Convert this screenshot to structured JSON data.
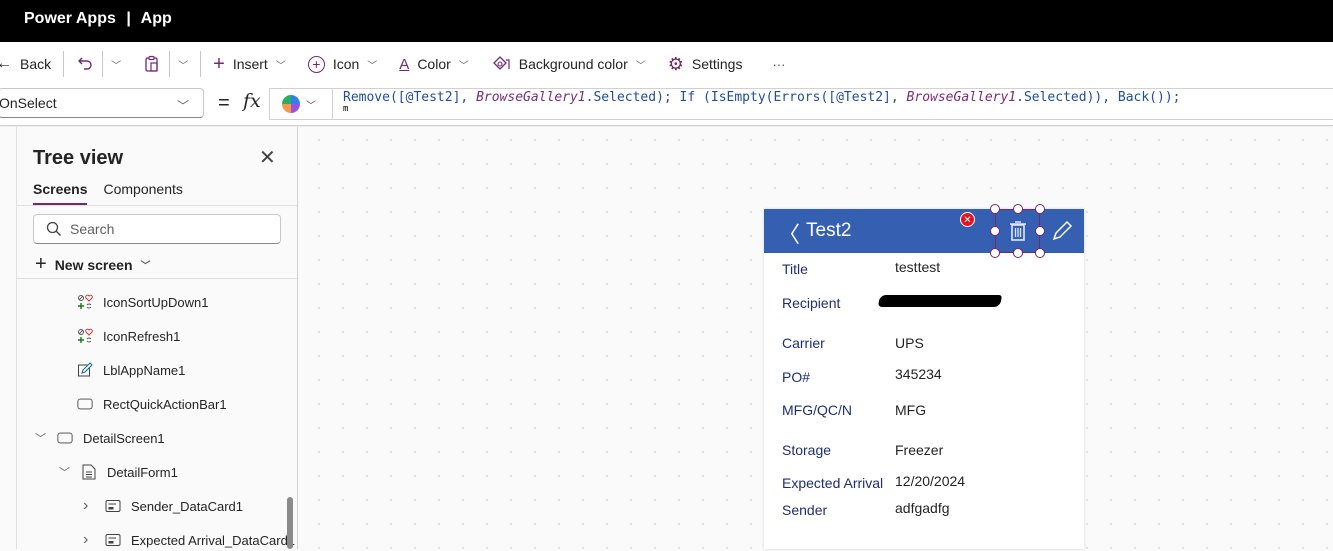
{
  "titlebar": {
    "app": "Power Apps",
    "separator": "|",
    "name": "App"
  },
  "toolbar": {
    "back": "Back",
    "insert": "Insert",
    "icon": "Icon",
    "color": "Color",
    "background_color": "Background color",
    "settings": "Settings",
    "more": "···"
  },
  "formula_bar": {
    "property": "OnSelect",
    "equals": "=",
    "fx": "fx",
    "formula_parts": [
      {
        "text": "Remove([@Test2], ",
        "style": "normal"
      },
      {
        "text": "BrowseGallery1",
        "style": "italic"
      },
      {
        "text": ".Selected); If (IsEmpty(Errors([@Test2], ",
        "style": "normal"
      },
      {
        "text": "BrowseGallery1",
        "style": "italic"
      },
      {
        "text": ".Selected)), Back());",
        "style": "normal"
      }
    ],
    "second_line": "m"
  },
  "tree_view": {
    "title": "Tree view",
    "tabs": [
      {
        "label": "Screens",
        "active": true
      },
      {
        "label": "Components",
        "active": false
      }
    ],
    "search_placeholder": "Search",
    "new_screen": "New screen",
    "items": [
      {
        "label": "IconSortUpDown1",
        "icon": "icons-control-icon",
        "level": 2,
        "expand": "none"
      },
      {
        "label": "IconRefresh1",
        "icon": "icons-control-icon",
        "level": 2,
        "expand": "none"
      },
      {
        "label": "LblAppName1",
        "icon": "label-edit-icon",
        "level": 2,
        "expand": "none"
      },
      {
        "label": "RectQuickActionBar1",
        "icon": "rectangle-icon",
        "level": 2,
        "expand": "none"
      },
      {
        "label": "DetailScreen1",
        "icon": "screen-icon",
        "level": 0,
        "expand": "expanded"
      },
      {
        "label": "DetailForm1",
        "icon": "form-icon",
        "level": 1,
        "expand": "expanded"
      },
      {
        "label": "Sender_DataCard1",
        "icon": "datacard-icon",
        "level": 2,
        "expand": "collapsed"
      },
      {
        "label": "Expected Arrival_DataCard1",
        "icon": "datacard-icon",
        "level": 2,
        "expand": "collapsed"
      }
    ]
  },
  "app_screen": {
    "header_title": "Test2",
    "header_color": "#3560b1",
    "selection_color": "#742774",
    "fields": [
      {
        "label": "Title",
        "value": "testtest"
      },
      {
        "label": "Recipient",
        "value": "[redacted]"
      },
      {
        "label": "Carrier",
        "value": "UPS"
      },
      {
        "label": "PO#",
        "value": "345234"
      },
      {
        "label": "MFG/QC/N",
        "value": "MFG"
      },
      {
        "label": "Storage",
        "value": "Freezer"
      },
      {
        "label": "Expected Arrival",
        "value": "12/20/2024"
      },
      {
        "label": "Sender",
        "value": "adfgadfg"
      }
    ]
  }
}
